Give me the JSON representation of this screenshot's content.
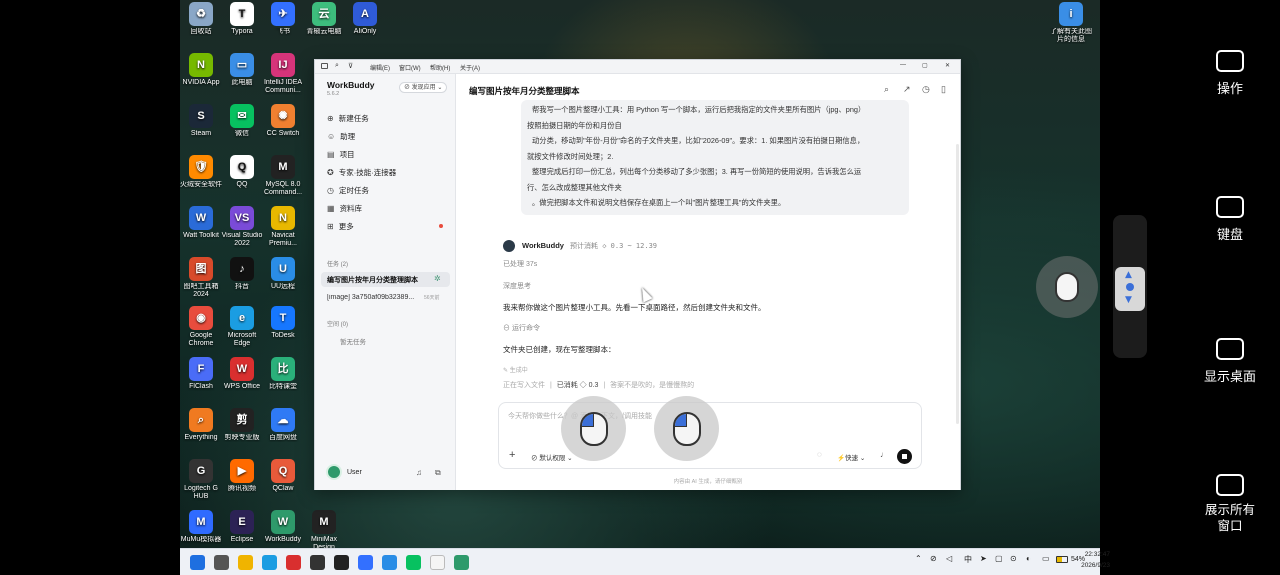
{
  "desktop_icons": [
    {
      "label": "回收站",
      "color": "#8aa7c7",
      "glyph": "♻"
    },
    {
      "label": "Typora",
      "color": "#ffffff",
      "glyph": "T"
    },
    {
      "label": "飞书",
      "color": "#3370ff",
      "glyph": "✈"
    },
    {
      "label": "青椒云电脑",
      "color": "#3dbd7d",
      "glyph": "云"
    },
    {
      "label": "AIiOnly",
      "color": "#2f5bd8",
      "glyph": "A"
    },
    {
      "label": "NVIDIA App",
      "color": "#76b900",
      "glyph": "N"
    },
    {
      "label": "此电脑",
      "color": "#3a8ee6",
      "glyph": "▭"
    },
    {
      "label": "IntelliJ IDEA Communi...",
      "color": "#d6347a",
      "glyph": "IJ"
    },
    {
      "label": "Steam",
      "color": "#1b2838",
      "glyph": "S"
    },
    {
      "label": "微信",
      "color": "#07c160",
      "glyph": "✉"
    },
    {
      "label": "CC Switch",
      "color": "#f08030",
      "glyph": "✺"
    },
    {
      "label": "火绒安全软件",
      "color": "#ff8a00",
      "glyph": "🛡"
    },
    {
      "label": "QQ",
      "color": "#ffffff",
      "glyph": "Q"
    },
    {
      "label": "MySQL 8.0 Command...",
      "color": "#222",
      "glyph": "M"
    },
    {
      "label": "Watt Toolkit",
      "color": "#2a6bd8",
      "glyph": "W"
    },
    {
      "label": "Visual Studio 2022",
      "color": "#7a4bd8",
      "glyph": "VS"
    },
    {
      "label": "Navicat Premiu...",
      "color": "#e8b800",
      "glyph": "N"
    },
    {
      "label": "图吧工具箱 2024",
      "color": "#d84a2a",
      "glyph": "图"
    },
    {
      "label": "抖音",
      "color": "#111",
      "glyph": "♪"
    },
    {
      "label": "UU远程",
      "color": "#2a8de6",
      "glyph": "U"
    },
    {
      "label": "Google Chrome",
      "color": "#e84c3d",
      "glyph": "◉"
    },
    {
      "label": "Microsoft Edge",
      "color": "#1b9de2",
      "glyph": "e"
    },
    {
      "label": "ToDesk",
      "color": "#1677ff",
      "glyph": "T"
    },
    {
      "label": "FlClash",
      "color": "#4a6cf7",
      "glyph": "F"
    },
    {
      "label": "WPS Office",
      "color": "#d92f2f",
      "glyph": "W"
    },
    {
      "label": "比特课堂",
      "color": "#2ab07a",
      "glyph": "比"
    },
    {
      "label": "Everything",
      "color": "#f07a20",
      "glyph": "⌕"
    },
    {
      "label": "剪映专业版",
      "color": "#222",
      "glyph": "剪"
    },
    {
      "label": "百度网盘",
      "color": "#2f7af5",
      "glyph": "☁"
    },
    {
      "label": "Logitech G HUB",
      "color": "#333",
      "glyph": "G"
    },
    {
      "label": "腾讯视频",
      "color": "#ff6a00",
      "glyph": "▶"
    },
    {
      "label": "QClaw",
      "color": "#e85a3a",
      "glyph": "Q"
    },
    {
      "label": "MuMu模拟器",
      "color": "#2f6bff",
      "glyph": "M"
    },
    {
      "label": "Eclipse",
      "color": "#2c2255",
      "glyph": "E"
    },
    {
      "label": "WorkBuddy",
      "color": "#2e9a6b",
      "glyph": "W"
    },
    {
      "label": "MiniMax Design",
      "color": "#222",
      "glyph": "M"
    },
    {
      "label": "了解有关此图片的信息",
      "color": "#3a8ee6",
      "glyph": "i"
    }
  ],
  "window": {
    "menu": [
      "编辑(E)",
      "窗口(W)",
      "帮助(H)",
      "关于(A)"
    ],
    "controls": [
      "—",
      "▢",
      "✕"
    ]
  },
  "sidebar": {
    "app_name": "WorkBuddy",
    "version": "5.6.2",
    "discover_btn": "发现应用",
    "nav": [
      {
        "label": "新建任务",
        "icon": "plus-icon"
      },
      {
        "label": "助理",
        "icon": "assistant-icon"
      },
      {
        "label": "项目",
        "icon": "project-icon"
      },
      {
        "label": "专家·技能·连接器",
        "icon": "expert-icon"
      },
      {
        "label": "定时任务",
        "icon": "clock-icon"
      },
      {
        "label": "资料库",
        "icon": "library-icon"
      },
      {
        "label": "更多",
        "icon": "more-icon"
      }
    ],
    "tasks_header": "任务 (2)",
    "tasks": [
      {
        "label": "编写图片按年月分类整理脚本",
        "meta": ""
      },
      {
        "label": "[image] 3a750af09b32389...",
        "meta": "56天前"
      }
    ],
    "space_header": "空间 (0)",
    "space_empty": "暂无任务",
    "user_name": "User"
  },
  "main": {
    "title": "编写图片按年月分类整理脚本",
    "user_message": [
      "帮我写一个图片整理小工具：用 Python 写一个脚本，运行后把我指定的文件夹里所有图片（jpg、png）",
      "按照拍摄日期的年份和月份自",
      "动分类，移动到\"年份-月份\"命名的子文件夹里，比如\"2026-09\"。要求：1. 如果图片没有拍摄日期信息，",
      "就按文件修改时间处理；2.",
      "整理完成后打印一份汇总，列出每个分类移动了多少张图；3. 再写一份简短的使用说明，告诉我怎么运",
      "行、怎么改成整理其他文件夹",
      "。做完把脚本文件和说明文档保存在桌面上一个叫\"图片整理工具\"的文件夹里。"
    ],
    "agent_name": "WorkBuddy",
    "agent_cost": "预计消耗 ◇ 0.3 ~ 12.39",
    "processed": "已处理 37s",
    "deep_think": "深度思考",
    "reply1": "我来帮你做这个图片整理小工具。先看一下桌面路径，然后创建文件夹和文件。",
    "run_cmd": "运行命令",
    "reply2": "文件夹已创建，现在写整理脚本：",
    "generating": "生成中",
    "status_writing": "正在写入文件",
    "status_used": "已消耗 ◇ 0.3",
    "status_note": "答案不是吹的，是慢慢熬的",
    "input_placeholder": "今天帮你做些什么？@ 添加上下文，/调用技能",
    "perm_label": "默认权限",
    "speed_label": "快速",
    "footer_note": "内容由 AI 生成，请仔细甄别"
  },
  "right_panel": [
    {
      "label": "操作"
    },
    {
      "label": "键盘"
    },
    {
      "label": "显示桌面"
    },
    {
      "label": "展示所有窗口"
    }
  ],
  "taskbar": {
    "time": "22:32:47",
    "date": "2026/9/23",
    "battery": "54%",
    "ime": "中"
  }
}
